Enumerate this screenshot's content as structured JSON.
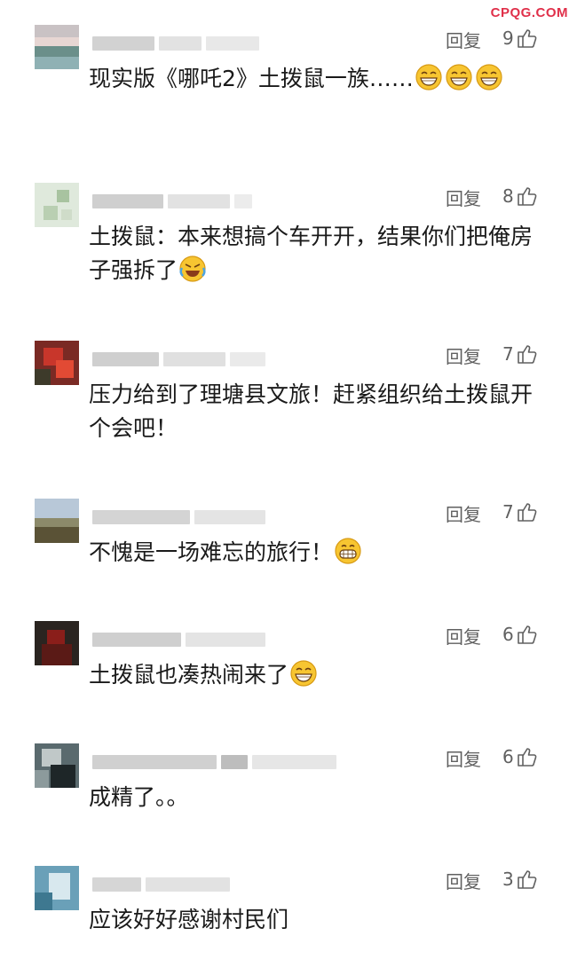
{
  "watermark": "CPQG.COM",
  "reply_label": "回复",
  "comments": [
    {
      "text": "现实版《哪吒2》土拨鼠一族……",
      "likes": "9"
    },
    {
      "text": "土拨鼠：本来想搞个车开开，结果你们把俺房子强拆了",
      "likes": "8"
    },
    {
      "text": "压力给到了理塘县文旅！赶紧组织给土拨鼠开个会吧！",
      "likes": "7"
    },
    {
      "text": "不愧是一场难忘的旅行！",
      "likes": "7"
    },
    {
      "text": "土拨鼠也凑热闹来了",
      "likes": "6"
    },
    {
      "text": "成精了。。",
      "likes": "6"
    },
    {
      "text": "应该好好感谢村民们",
      "likes": "3"
    }
  ],
  "icons": {
    "like": "thumbs-up-icon",
    "grin": "grinning-face-icon",
    "laugh_cry": "rolling-laughing-face-icon",
    "avatar": "blurred-avatar-icon"
  },
  "colors": {
    "text": "#1a1a1a",
    "meta": "#606060",
    "watermark": "#e0304a",
    "emoji": "#f7c531"
  }
}
